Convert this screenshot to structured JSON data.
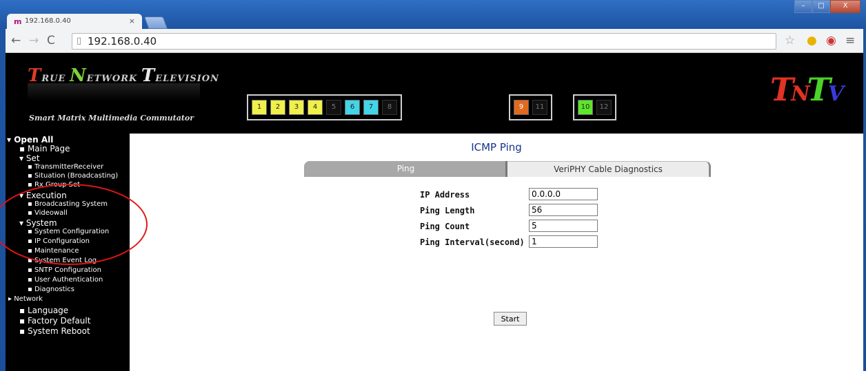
{
  "browser": {
    "tab_title": "192.168.0.40",
    "tab_close": "×",
    "url": "192.168.0.40",
    "window_controls": [
      "–",
      "□",
      "X"
    ]
  },
  "banner": {
    "logo": {
      "w1_big": "T",
      "w1": "RUE ",
      "w2_big": "N",
      "w2": "ETWORK ",
      "w3_big": "T",
      "w3": "ELEVISION"
    },
    "subtitle": "Smart Matrix Multimedia Commutator",
    "channels_a": [
      {
        "label": "1",
        "color": "yellow"
      },
      {
        "label": "2",
        "color": "yellow"
      },
      {
        "label": "3",
        "color": "yellow"
      },
      {
        "label": "4",
        "color": "yellow"
      },
      {
        "label": "5",
        "color": "dark"
      },
      {
        "label": "6",
        "color": "cyan"
      },
      {
        "label": "7",
        "color": "cyan"
      },
      {
        "label": "8",
        "color": "dark"
      }
    ],
    "channels_b": [
      {
        "label": "9",
        "color": "orange"
      },
      {
        "label": "11",
        "color": "dark"
      }
    ],
    "channels_c": [
      {
        "label": "10",
        "color": "green"
      },
      {
        "label": "12",
        "color": "dark"
      }
    ],
    "tntv": {
      "t1": "T",
      "n": "N",
      "t2": "T",
      "v": "V"
    }
  },
  "sidebar": {
    "open_all": "▾ Open All",
    "main_page": "▪ Main Page",
    "set": "▾ Set",
    "set_items": [
      "▪ TransmitterReceiver",
      "▪ Situation (Broadcasting)",
      "▪ Rx Group Set"
    ],
    "execution": "▾ Execution",
    "execution_items": [
      "▪ Broadcasting System",
      "▪ Videowall"
    ],
    "system": "▾ System",
    "system_items": [
      "▪ System Configuration",
      "▪ IP Configuration",
      "▪ Maintenance",
      "▪ System Event Log",
      "▪ SNTP Configuration",
      "▪ User Authentication",
      "▪ Diagnostics"
    ],
    "network": "▸ Network",
    "language": "▪ Language",
    "factory_default": "▪ Factory Default",
    "system_reboot": "▪ System Reboot"
  },
  "main": {
    "title": "ICMP Ping",
    "tab_ping": "Ping",
    "tab_diag": "VeriPHY Cable Diagnostics",
    "ip_label": "IP Address",
    "ip_value": "0.0.0.0",
    "len_label": "Ping Length",
    "len_value": "56",
    "count_label": "Ping Count",
    "count_value": "5",
    "interval_label": "Ping Interval(second)",
    "interval_value": "1",
    "start": "Start"
  },
  "colors": {
    "annotation": "#e01515",
    "title_blue": "#17338a"
  }
}
